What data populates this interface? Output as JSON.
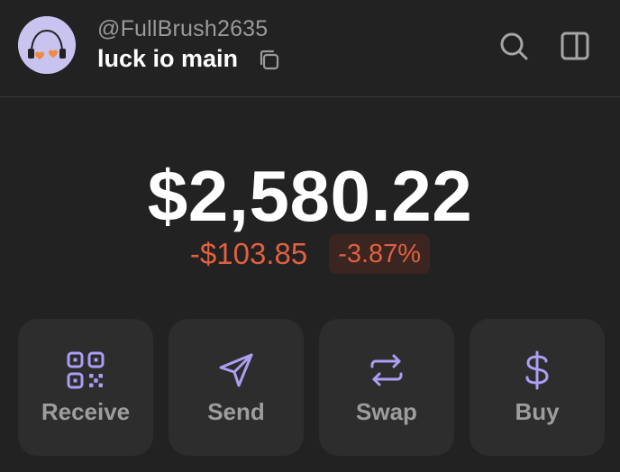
{
  "header": {
    "username": "@FullBrush2635",
    "account_name": "luck io main",
    "avatar_icon": "headphones-hearts-avatar",
    "copy_icon": "copy-icon",
    "search_icon": "search-icon",
    "sidepanel_icon": "sidepanel-icon"
  },
  "portfolio": {
    "balance": "$2,580.22",
    "change_amount": "-$103.85",
    "change_percent": "-3.87%"
  },
  "actions": [
    {
      "label": "Receive",
      "icon": "qr-code-icon"
    },
    {
      "label": "Send",
      "icon": "send-icon"
    },
    {
      "label": "Swap",
      "icon": "swap-icon"
    },
    {
      "label": "Buy",
      "icon": "dollar-icon"
    }
  ],
  "colors": {
    "background": "#222222",
    "card": "#2d2d2d",
    "accent": "#ab9ff2",
    "negative": "#e25f40",
    "muted_text": "#9d9d9d"
  }
}
